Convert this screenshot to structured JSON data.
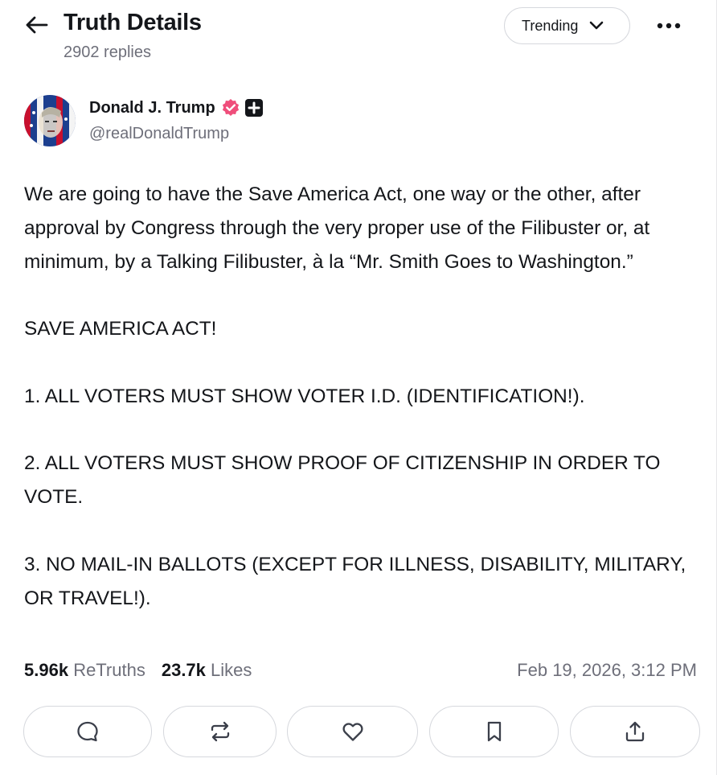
{
  "header": {
    "title": "Truth Details",
    "subtitle": "2902 replies",
    "sort_label": "Trending"
  },
  "icons": {
    "back": "arrow-left-icon",
    "sort": "chevron-down-icon",
    "more": "ellipsis-icon",
    "verified": "verified-badge-icon",
    "plus": "plus-badge-icon"
  },
  "author": {
    "name": "Donald J. Trump",
    "handle": "@realDonaldTrump"
  },
  "post": {
    "paragraphs": [
      "We are going to have the Save America Act, one way or the other, after approval by Congress through the very proper use of the Filibuster or, at minimum, by a Talking Filibuster, à la “Mr. Smith Goes to Washington.”",
      "SAVE AMERICA ACT!",
      "1. ALL VOTERS MUST SHOW VOTER I.D. (IDENTIFICATION!).",
      "2. ALL VOTERS MUST SHOW PROOF OF CITIZENSHIP IN ORDER TO VOTE.",
      "3. NO MAIL-IN BALLOTS (EXCEPT FOR ILLNESS, DISABILITY, MILITARY, OR TRAVEL!)."
    ]
  },
  "stats": {
    "retruths_count": "5.96k",
    "retruths_label": "ReTruths",
    "likes_count": "23.7k",
    "likes_label": "Likes",
    "timestamp": "Feb 19, 2026, 3:12 PM"
  },
  "actions": [
    {
      "name": "reply",
      "icon": "speech-bubble-icon"
    },
    {
      "name": "retruth",
      "icon": "repost-icon"
    },
    {
      "name": "like",
      "icon": "heart-icon"
    },
    {
      "name": "bookmark",
      "icon": "bookmark-icon"
    },
    {
      "name": "share",
      "icon": "share-icon"
    }
  ],
  "colors": {
    "text": "#14161a",
    "muted": "#6e6f7a",
    "border": "#d6d8dd",
    "verified": "#ef4e7b"
  }
}
